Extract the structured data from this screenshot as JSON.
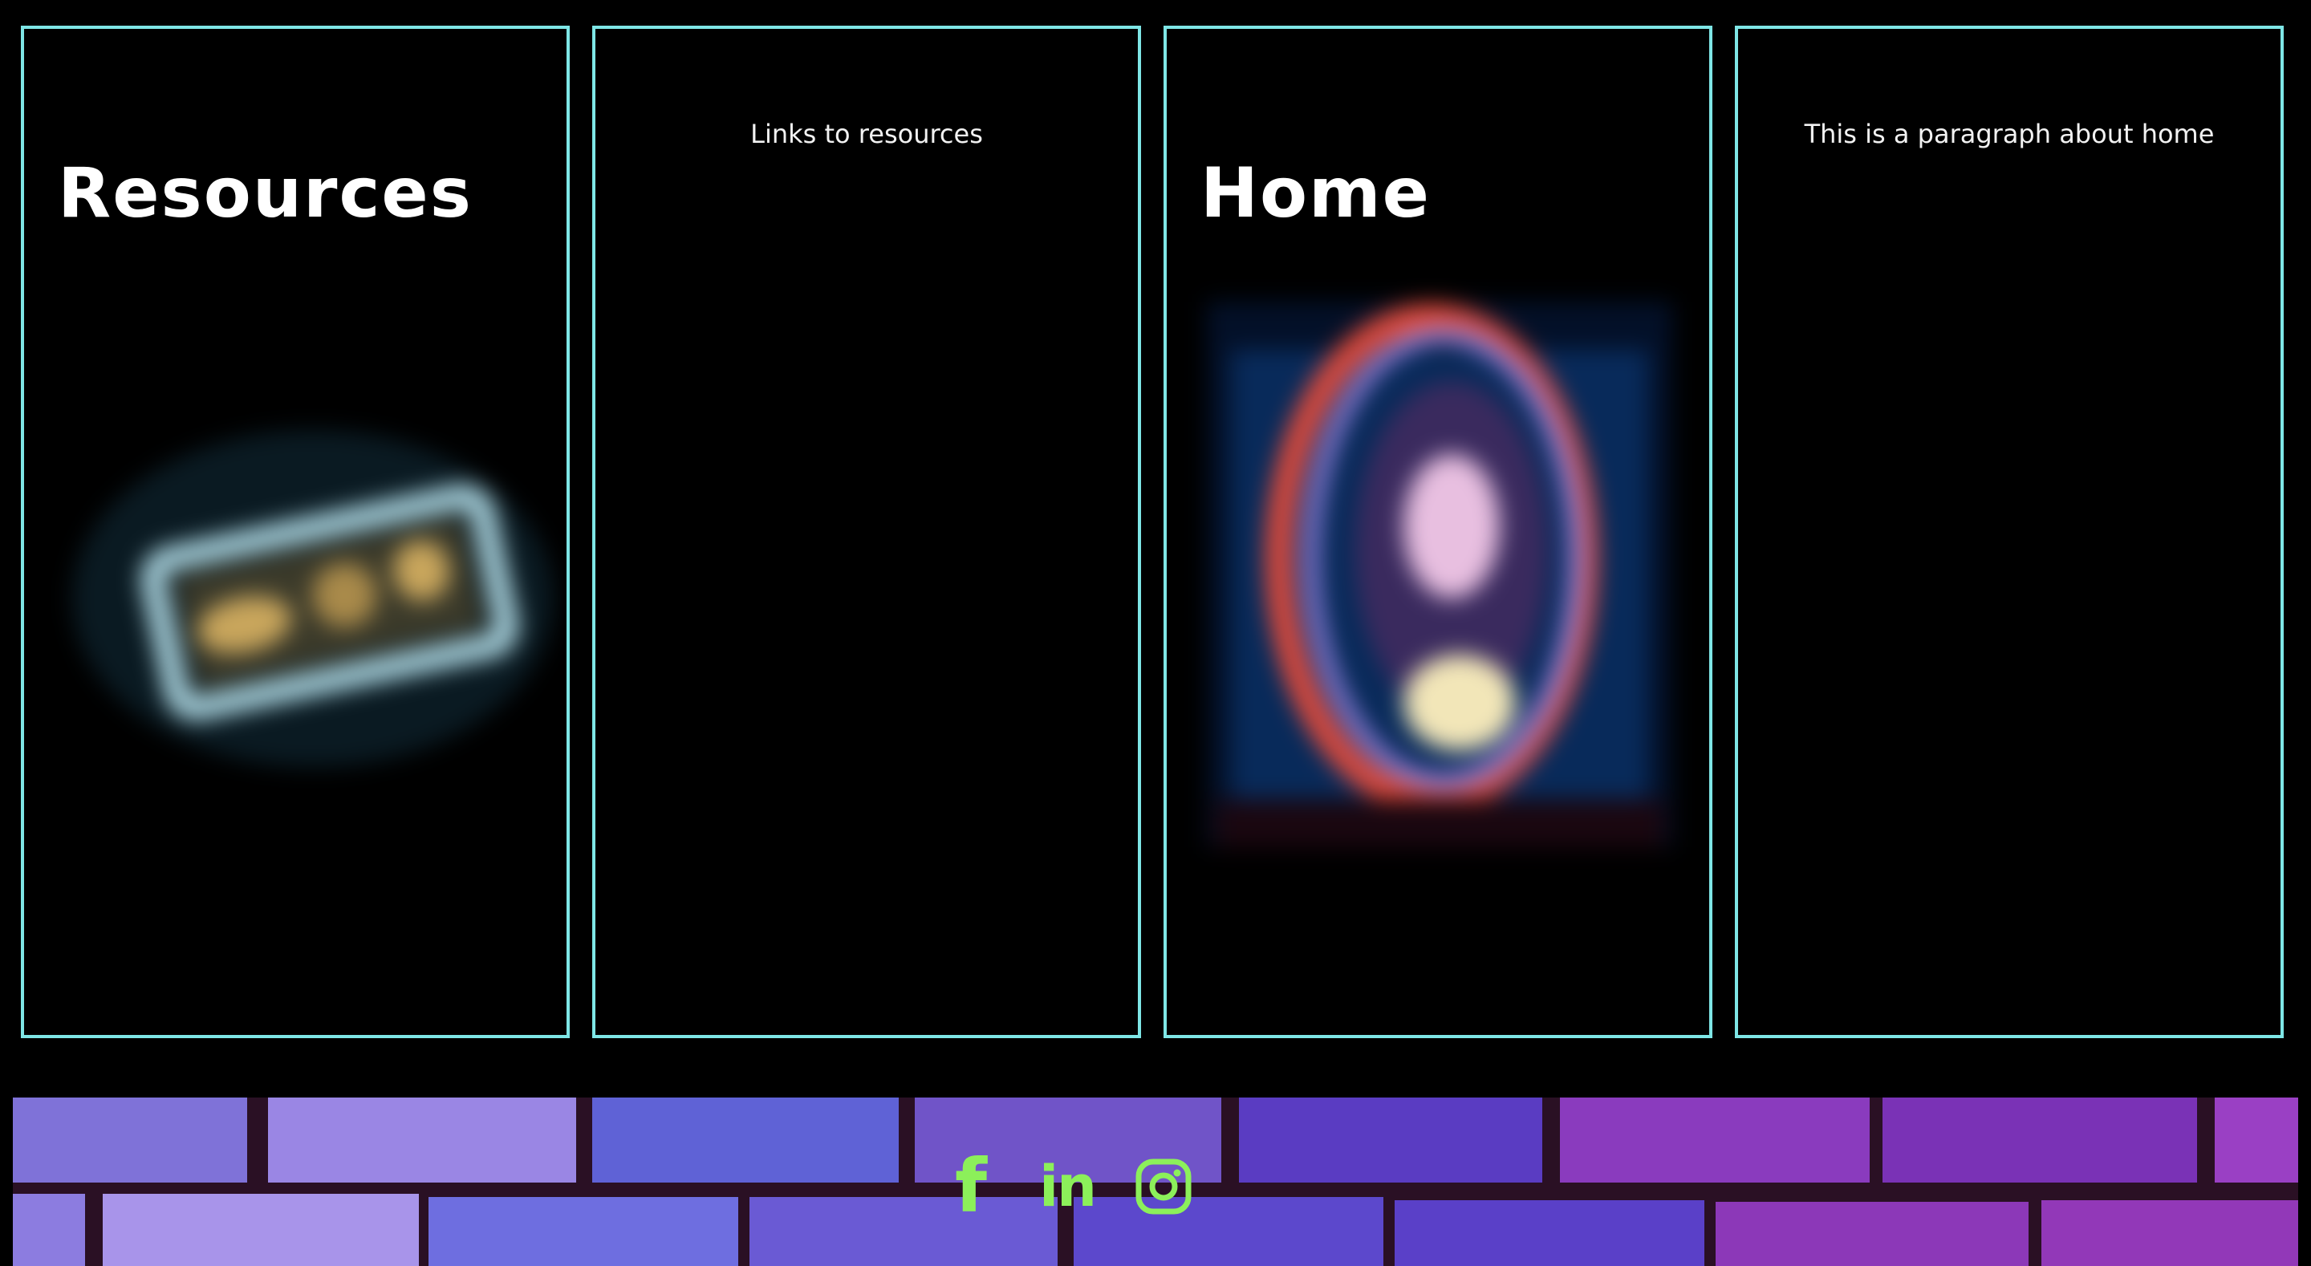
{
  "cards": [
    {
      "title": "Resources"
    },
    {
      "text": "Links to resources"
    },
    {
      "title": "Home"
    },
    {
      "text": "This is a paragraph about home"
    }
  ],
  "social": {
    "icons": [
      "facebook-icon",
      "linkedin-icon",
      "instagram-icon"
    ],
    "facebook_glyph": "f",
    "linkedin_glyph": "in"
  },
  "colors": {
    "border": "#7ee6e6",
    "icon": "#8cf05a",
    "background": "#000000"
  }
}
